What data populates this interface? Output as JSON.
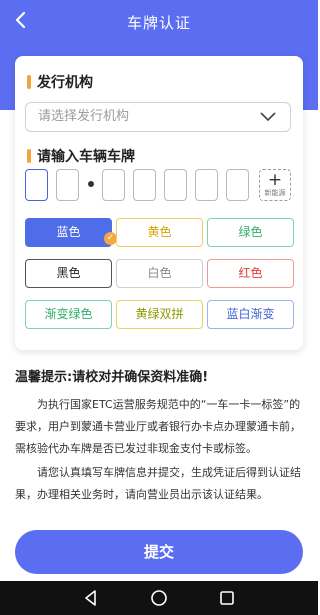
{
  "header": {
    "title": "车牌认证",
    "back_icon": "chevron-left-icon"
  },
  "issuer": {
    "heading": "发行机构",
    "placeholder": "请选择发行机构"
  },
  "plate": {
    "heading": "请输入车辆车牌",
    "new_energy_label": "新能源",
    "new_energy_symbol": "+"
  },
  "colors": [
    {
      "label": "蓝色",
      "bg": "#4f6de8",
      "border": "#4f6de8",
      "text": "#ffffff",
      "selected": true
    },
    {
      "label": "黄色",
      "bg": "#ffffff",
      "border": "#f0cf6a",
      "text": "#d9a400",
      "selected": false
    },
    {
      "label": "绿色",
      "bg": "#ffffff",
      "border": "#7fd4a8",
      "text": "#2fae6c",
      "selected": false
    },
    {
      "label": "黑色",
      "bg": "#ffffff",
      "border": "#555555",
      "text": "#222222",
      "selected": false
    },
    {
      "label": "白色",
      "bg": "#ffffff",
      "border": "#cfcfcf",
      "text": "#888888",
      "selected": false
    },
    {
      "label": "红色",
      "bg": "#ffffff",
      "border": "#ef9a9a",
      "text": "#e53935",
      "selected": false
    },
    {
      "label": "渐变绿色",
      "bg": "#ffffff",
      "border": "#7fd4a8",
      "text": "#2fae6c",
      "selected": false
    },
    {
      "label": "黄绿双拼",
      "bg": "#ffffff",
      "border": "#e4d66a",
      "text": "#8c9a00",
      "selected": false
    },
    {
      "label": "蓝白渐变",
      "bg": "#ffffff",
      "border": "#9db4ec",
      "text": "#3f63d6",
      "selected": false
    }
  ],
  "tips": {
    "title": "温馨提示:请校对并确保资料准确!",
    "p1": "为执行国家ETC运营服务规范中的“一车一卡一标签”的要求，用户到蒙通卡营业厅或者银行办卡点办理蒙通卡前，需核验代办车牌是否已发过非现金支付卡或标签。",
    "p2": "请您认真填写车牌信息并提交，生成凭证后得到认证结果，办理相关业务时，请向营业员出示该认证结果。"
  },
  "submit_label": "提交",
  "theme": {
    "primary": "#5b6ef2",
    "accent": "#f6a23d"
  }
}
